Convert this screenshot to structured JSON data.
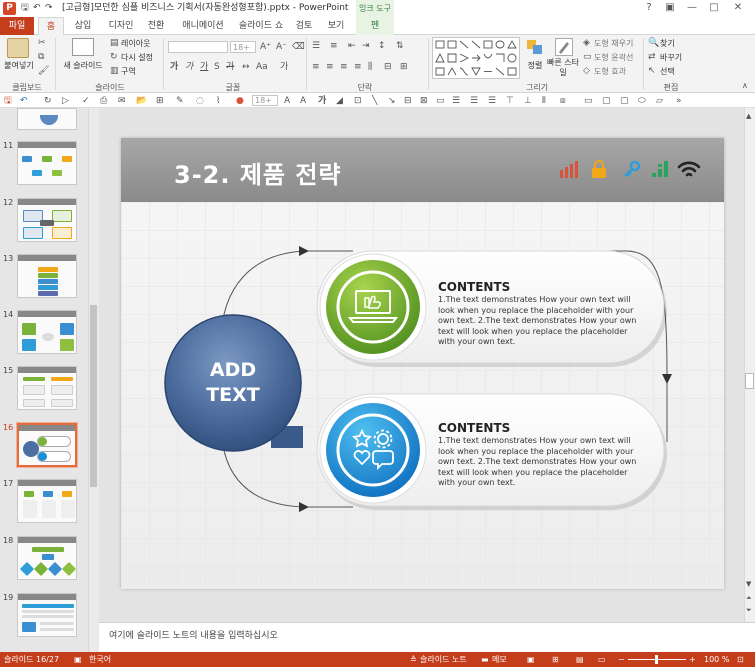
{
  "window": {
    "title": "[고급형]모던한 심플 비즈니스 기획서(자동완성형포함).pptx - PowerPoint",
    "context_tab": "잉크 도구"
  },
  "ribbon_tabs": [
    "파일",
    "홈",
    "삽입",
    "디자인",
    "전환",
    "애니메이션",
    "슬라이드 쇼",
    "검토",
    "보기",
    "펜"
  ],
  "ribbon": {
    "clipboard": {
      "paste": "붙여넣기",
      "label": "클립보드"
    },
    "slides": {
      "new_slide": "새 슬라이드",
      "layout": "레이아웃",
      "reset": "다시 설정",
      "section": "구역",
      "label": "슬라이드"
    },
    "font": {
      "label": "글꼴",
      "size": "18+"
    },
    "paragraph": {
      "label": "단락"
    },
    "drawing": {
      "arrange": "정렬",
      "quick_styles": "빠른 스타일",
      "fill": "도형 채우기",
      "outline": "도형 윤곽선",
      "effects": "도형 효과",
      "label": "그리기"
    },
    "editing": {
      "find": "찾기",
      "replace": "바꾸기",
      "select": "선택",
      "label": "편집"
    }
  },
  "qat": {
    "font_size": "18+"
  },
  "thumbnails": [
    {
      "num": "11"
    },
    {
      "num": "12"
    },
    {
      "num": "13"
    },
    {
      "num": "14"
    },
    {
      "num": "15"
    },
    {
      "num": "16"
    },
    {
      "num": "17"
    },
    {
      "num": "18"
    },
    {
      "num": "19"
    }
  ],
  "slide": {
    "title": "3-2. 제품 전략",
    "center_line1": "ADD",
    "center_line2": "TEXT",
    "items": [
      {
        "heading": "CONTENTS",
        "body": "1.The text demonstrates How your own text will look when you replace the placeholder with your own text. 2.The text demonstrates How your own text will look when you replace the placeholder with your own text."
      },
      {
        "heading": "CONTENTS",
        "body": "1.The text demonstrates How your own text will look when you replace the placeholder with your own text. 2.The text demonstrates How your own text will look when you replace the placeholder with your own text."
      }
    ],
    "icon_colors": [
      "#d9533b",
      "#f0a818",
      "#2f9ed8",
      "#27a35d",
      "#222222"
    ]
  },
  "notes_placeholder": "여기에 슬라이드 노트의 내용을 입력하십시오",
  "status": {
    "slide": "슬라이드 16/27",
    "language": "한국어",
    "notes": "슬라이드 노트",
    "comments": "메모",
    "zoom": "100 %"
  }
}
